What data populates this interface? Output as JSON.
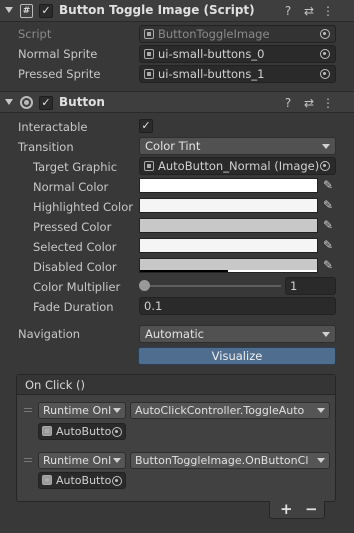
{
  "script_component": {
    "title": "Button Toggle Image (Script)",
    "enabled": true,
    "fields": {
      "script_label": "Script",
      "script_value": "ButtonToggleImage",
      "normal_sprite_label": "Normal Sprite",
      "normal_sprite_value": "ui-small-buttons_0",
      "pressed_sprite_label": "Pressed Sprite",
      "pressed_sprite_value": "ui-small-buttons_1"
    }
  },
  "button_component": {
    "title": "Button",
    "enabled": true,
    "interactable_label": "Interactable",
    "interactable_checked": true,
    "transition_label": "Transition",
    "transition_value": "Color Tint",
    "target_graphic_label": "Target Graphic",
    "target_graphic_value": "AutoButton_Normal (Image)",
    "colors": [
      {
        "label": "Normal Color",
        "color": "#ffffff"
      },
      {
        "label": "Highlighted Color",
        "color": "#f5f5f5"
      },
      {
        "label": "Pressed Color",
        "color": "#c8c8c8"
      },
      {
        "label": "Selected Color",
        "color": "#f5f5f5"
      },
      {
        "label": "Disabled Color",
        "color": "#c8c8c8"
      }
    ],
    "color_multiplier_label": "Color Multiplier",
    "color_multiplier_value": "1",
    "fade_duration_label": "Fade Duration",
    "fade_duration_value": "0.1",
    "navigation_label": "Navigation",
    "navigation_value": "Automatic",
    "visualize_label": "Visualize"
  },
  "on_click": {
    "title": "On Click ()",
    "entries": [
      {
        "runtime": "Runtime Onl",
        "function": "AutoClickController.ToggleAuto",
        "object": "AutoButto"
      },
      {
        "runtime": "Runtime Onl",
        "function": "ButtonToggleImage.OnButtonCl",
        "object": "AutoButto"
      }
    ],
    "add_label": "+",
    "remove_label": "−"
  },
  "icons": {
    "help": "?",
    "settings": "⇄",
    "more": "⋮",
    "checkmark": "✓",
    "eyedropper": "✎"
  }
}
